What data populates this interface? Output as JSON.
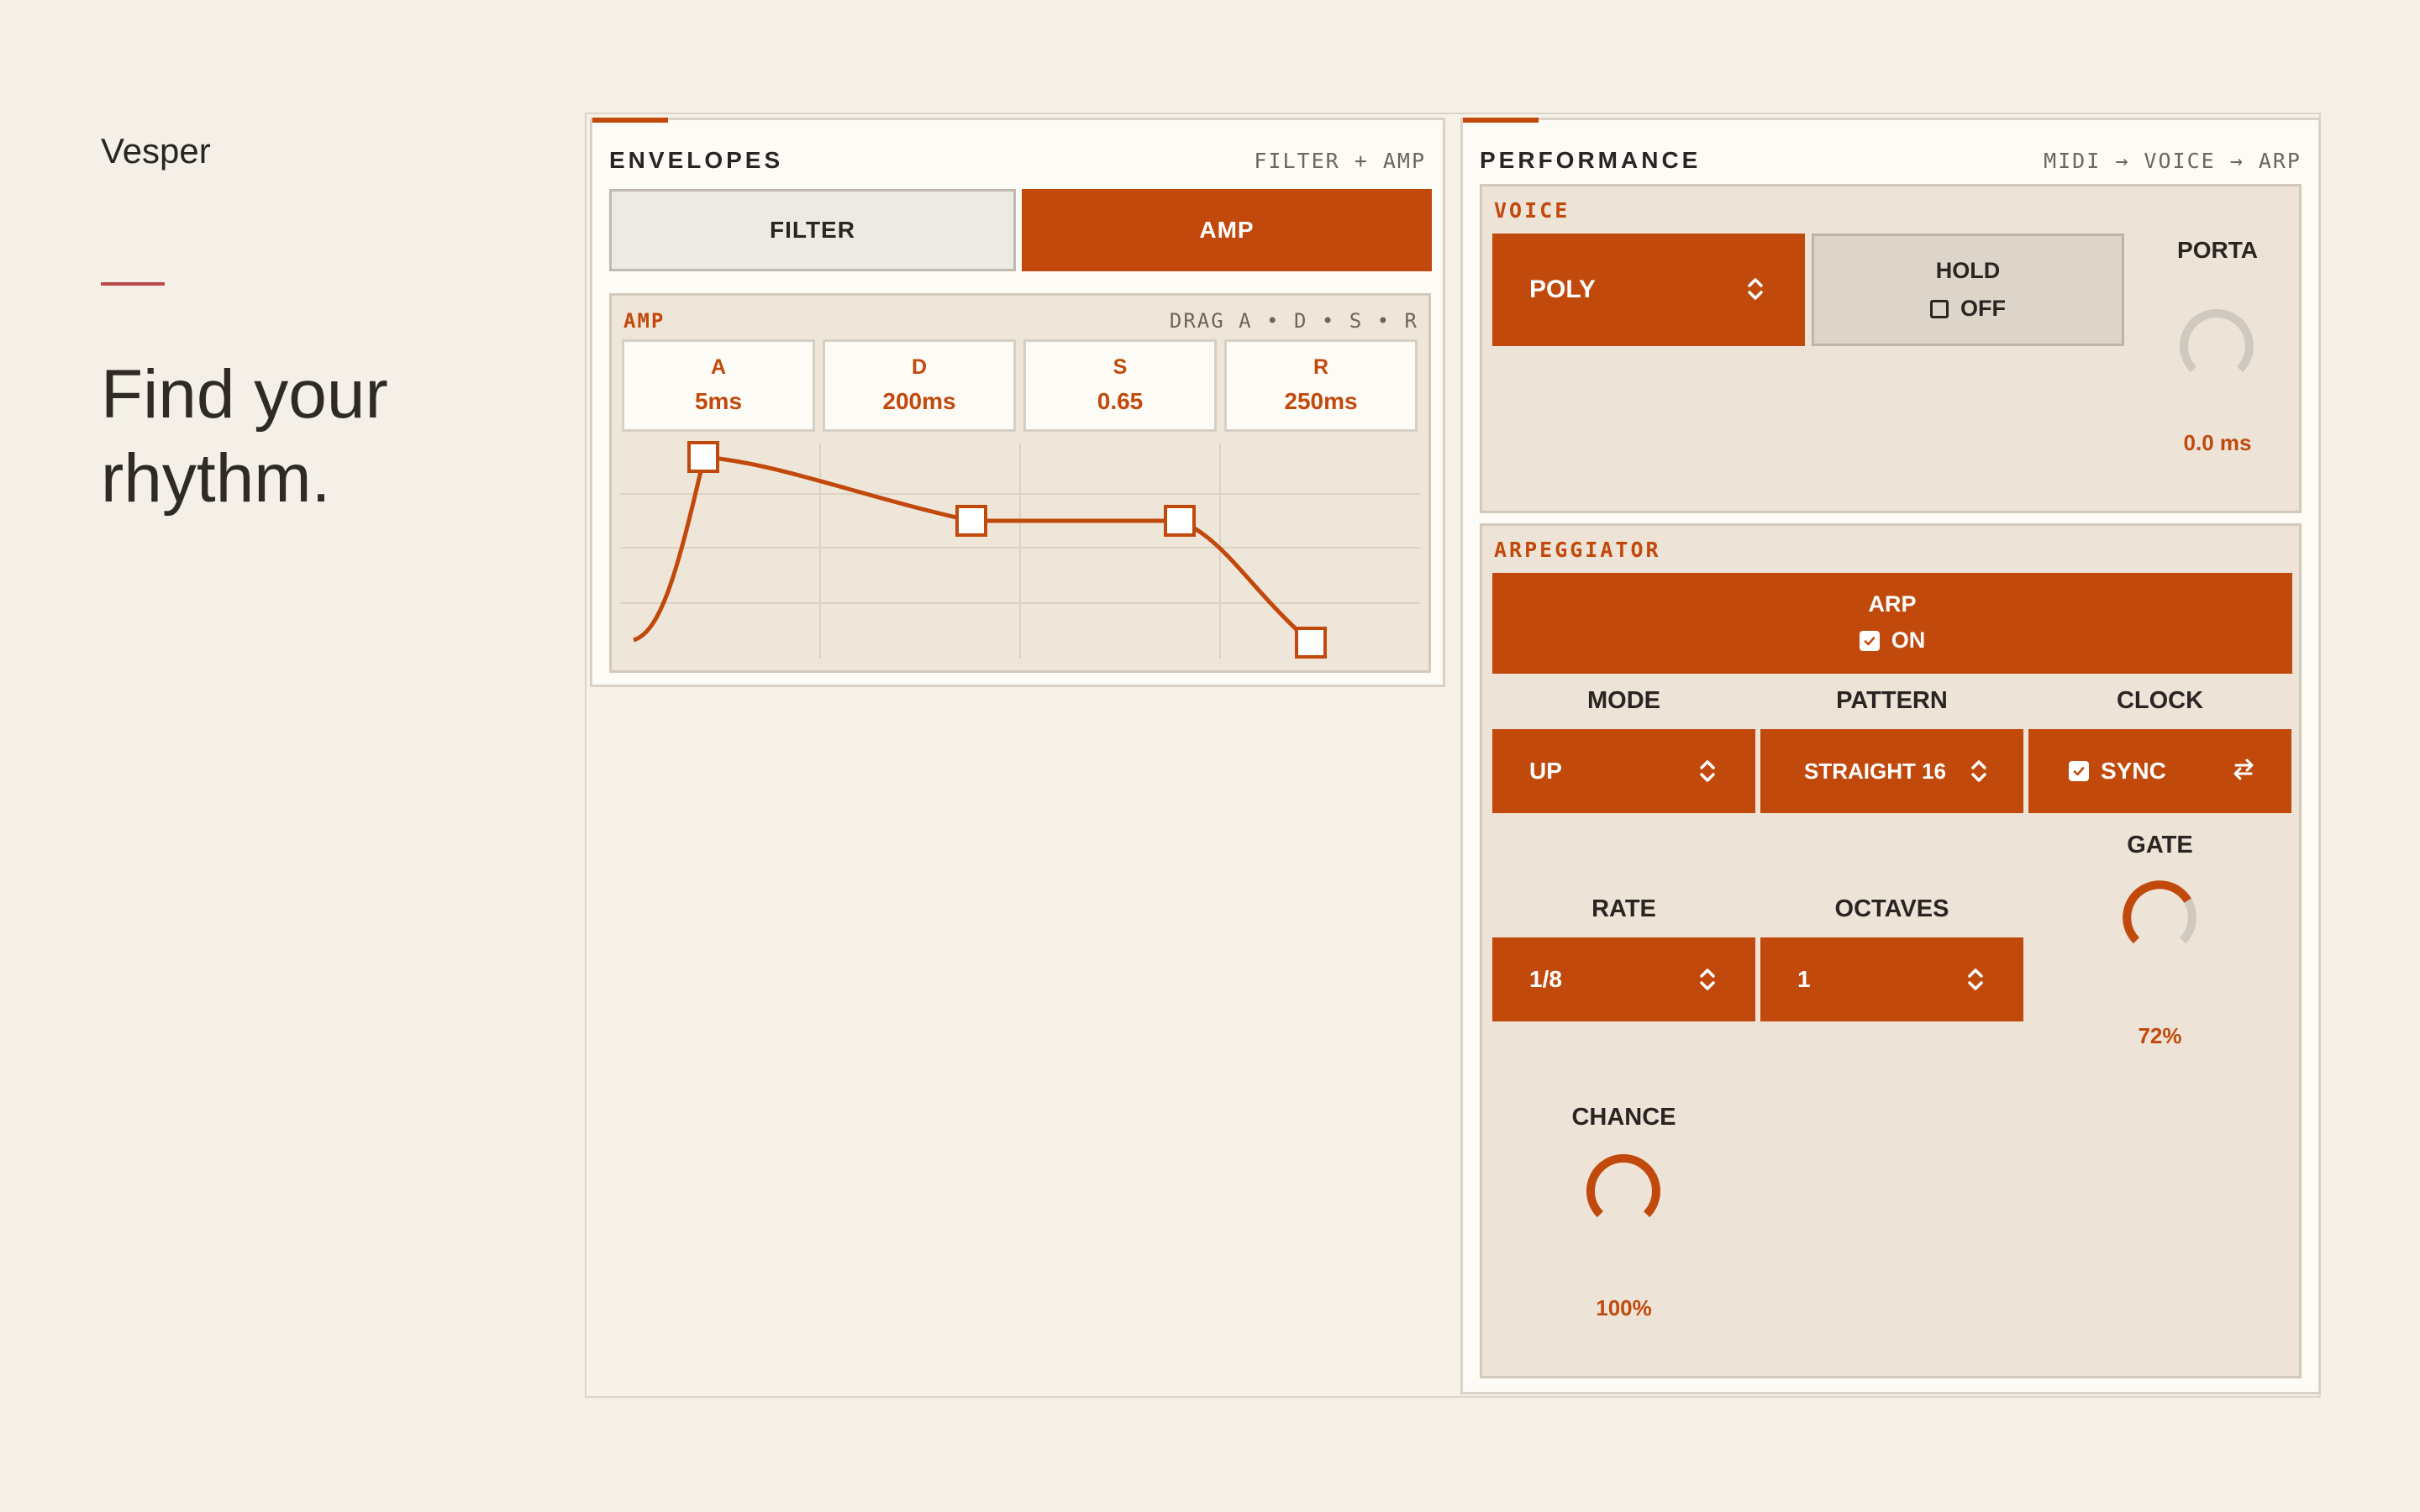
{
  "brand": "Vesper",
  "headline": {
    "line1": "Find your",
    "line2": "rhythm."
  },
  "envelopes": {
    "title": "ENVELOPES",
    "meta": "FILTER + AMP",
    "tabs": [
      {
        "label": "FILTER",
        "active": false
      },
      {
        "label": "AMP",
        "active": true
      }
    ],
    "editor": {
      "label": "AMP",
      "hint": "DRAG A • D • S • R",
      "params": [
        {
          "key": "A",
          "value": "5ms"
        },
        {
          "key": "D",
          "value": "200ms"
        },
        {
          "key": "S",
          "value": "0.65"
        },
        {
          "key": "R",
          "value": "250ms"
        }
      ]
    }
  },
  "performance": {
    "title": "PERFORMANCE",
    "meta": "MIDI → VOICE → ARP",
    "voice": {
      "label": "VOICE",
      "mode": "POLY",
      "hold": {
        "label": "HOLD",
        "state": "OFF",
        "checked": false
      },
      "porta": {
        "label": "PORTA",
        "value": "0.0 ms",
        "level": 0.0
      }
    },
    "arpeggiator": {
      "label": "ARPEGGIATOR",
      "arp": {
        "label": "ARP",
        "state": "ON",
        "checked": true
      },
      "mode": {
        "label": "MODE",
        "value": "UP"
      },
      "pattern": {
        "label": "PATTERN",
        "value": "STRAIGHT 16"
      },
      "clock": {
        "label": "CLOCK",
        "value": "SYNC",
        "checked": true
      },
      "gate": {
        "label": "GATE",
        "value": "72%",
        "level": 0.72
      },
      "rate": {
        "label": "RATE",
        "value": "1/8"
      },
      "octaves": {
        "label": "OCTAVES",
        "value": "1"
      },
      "chance": {
        "label": "CHANCE",
        "value": "100%",
        "level": 1.0
      }
    }
  },
  "colors": {
    "accent": "#c2490c",
    "background": "#f4f0e7",
    "track": "#cfc9c0"
  }
}
